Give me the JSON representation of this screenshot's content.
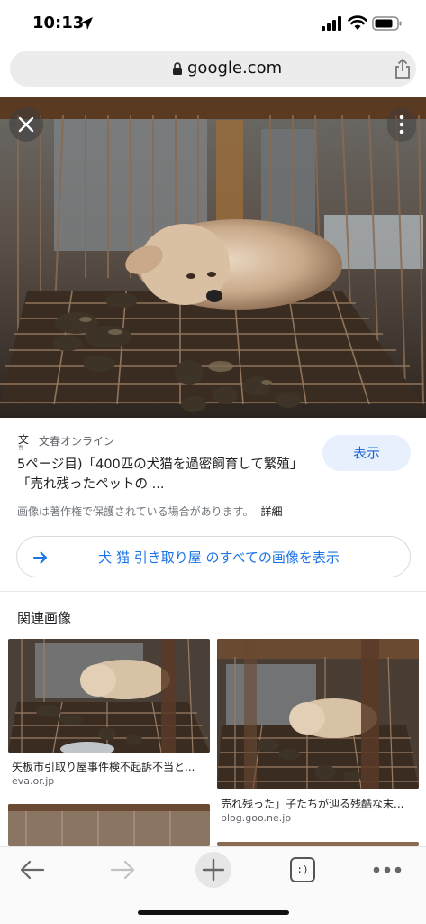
{
  "status_bar": {
    "time": "10:13"
  },
  "url_bar": {
    "domain": "google.com"
  },
  "result": {
    "source": "文春オンライン",
    "title": "5ページ目)「400匹の犬猫を過密飼育して繁殖」「売れ残ったペットの ...",
    "visit_label": "表示",
    "copyright_notice": "画像は著作権で保護されている場合があります。",
    "details_label": "詳細"
  },
  "all_images": {
    "label": "犬 猫 引き取り屋 のすべての画像を表示"
  },
  "related": {
    "heading": "関連画像",
    "items": [
      {
        "title": "矢板市引取り屋事件検不起訴不当と...",
        "domain": "eva.or.jp"
      },
      {
        "title": "売れ残った」子たちが辿る残酷な末...",
        "domain": "blog.goo.ne.jp"
      }
    ]
  },
  "toolbar": {
    "tabs_icon_text": ":)"
  },
  "colors": {
    "accent": "#1a73e8",
    "visit_bg": "#e8f0fe",
    "url_bar_bg": "#ececec"
  }
}
